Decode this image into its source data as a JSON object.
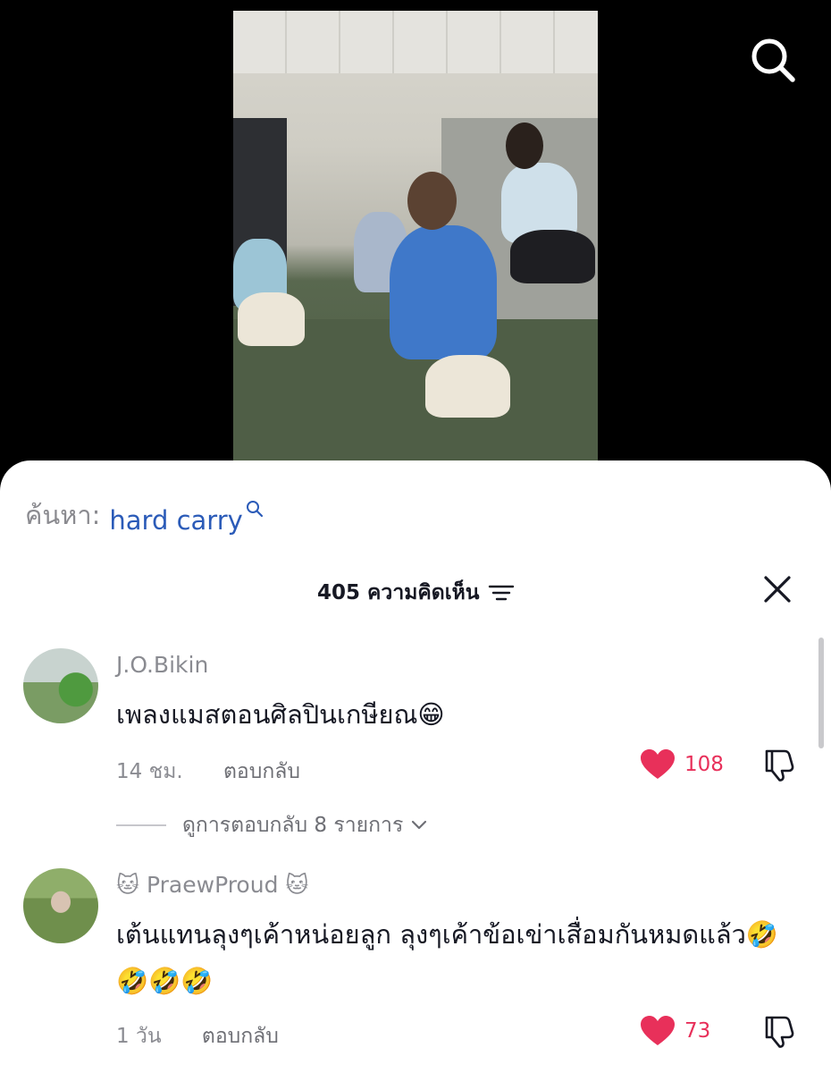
{
  "colors": {
    "accent_link": "#2b5bb8",
    "like_red": "#e8305a",
    "muted": "#8a8b91",
    "text": "#161823"
  },
  "video": {
    "search_icon": "search-icon"
  },
  "search": {
    "prefix": "ค้นหา:",
    "term": "hard carry"
  },
  "comments_header": {
    "count": "405",
    "label": "ความคิดเห็น",
    "sort_icon": "sort-icon",
    "close_icon": "close-icon"
  },
  "comments": [
    {
      "username": "J.O.Bikin",
      "text": "เพลงแมสตอนศิลปินเกษียณ😁",
      "time": "14 ชม.",
      "reply_label": "ตอบกลับ",
      "likes": "108",
      "view_replies": "ดูการตอบกลับ 8 รายการ"
    },
    {
      "username": "🐱 PraewProud 🐱",
      "text": "เต้นแทนลุงๆเค้าหน่อยลูก ลุงๆเค้าข้อเข่าเสื่อมกันหมดแล้ว🤣🤣🤣🤣",
      "time": "1 วัน",
      "reply_label": "ตอบกลับ",
      "likes": "73"
    }
  ]
}
